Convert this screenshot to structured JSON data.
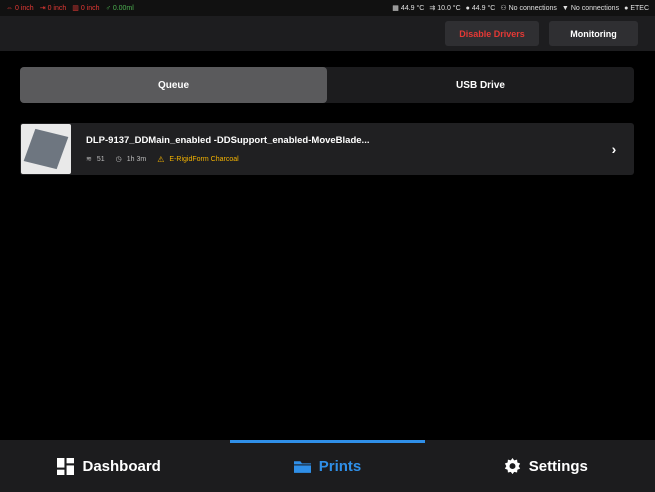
{
  "status_bar": {
    "left": [
      {
        "icon": "axis-z-icon",
        "value": "0 inch",
        "color": "#e53935"
      },
      {
        "icon": "axis-x-icon",
        "value": "0 inch",
        "color": "#e53935"
      },
      {
        "icon": "axis-y-icon",
        "value": "0 inch",
        "color": "#e53935"
      },
      {
        "icon": "resin-icon",
        "value": "0.00ml",
        "color": "#4caf50"
      }
    ],
    "right": [
      {
        "icon": "thermometer-icon",
        "value": "44.9 °C"
      },
      {
        "icon": "fan-temp-icon",
        "value": "10.0 °C"
      },
      {
        "icon": "drop-icon",
        "value": "44.9 °C"
      },
      {
        "icon": "network-icon",
        "value": "No connections"
      },
      {
        "icon": "wifi-icon",
        "value": "No connections"
      },
      {
        "icon": "circle-icon",
        "value": "ETEC"
      }
    ]
  },
  "header": {
    "disable_drivers": "Disable Drivers",
    "monitoring": "Monitoring"
  },
  "tabs": {
    "queue": "Queue",
    "usb": "USB Drive",
    "active": "queue"
  },
  "file": {
    "name": "DLP-9137_DDMain_enabled -DDSupport_enabled-MoveBlade...",
    "layers": "51",
    "duration": "1h 3m",
    "material": "E-RigidForm Charcoal"
  },
  "nav": {
    "dashboard": "Dashboard",
    "prints": "Prints",
    "settings": "Settings",
    "active": "prints",
    "accent_color": "#2f8fe8"
  }
}
